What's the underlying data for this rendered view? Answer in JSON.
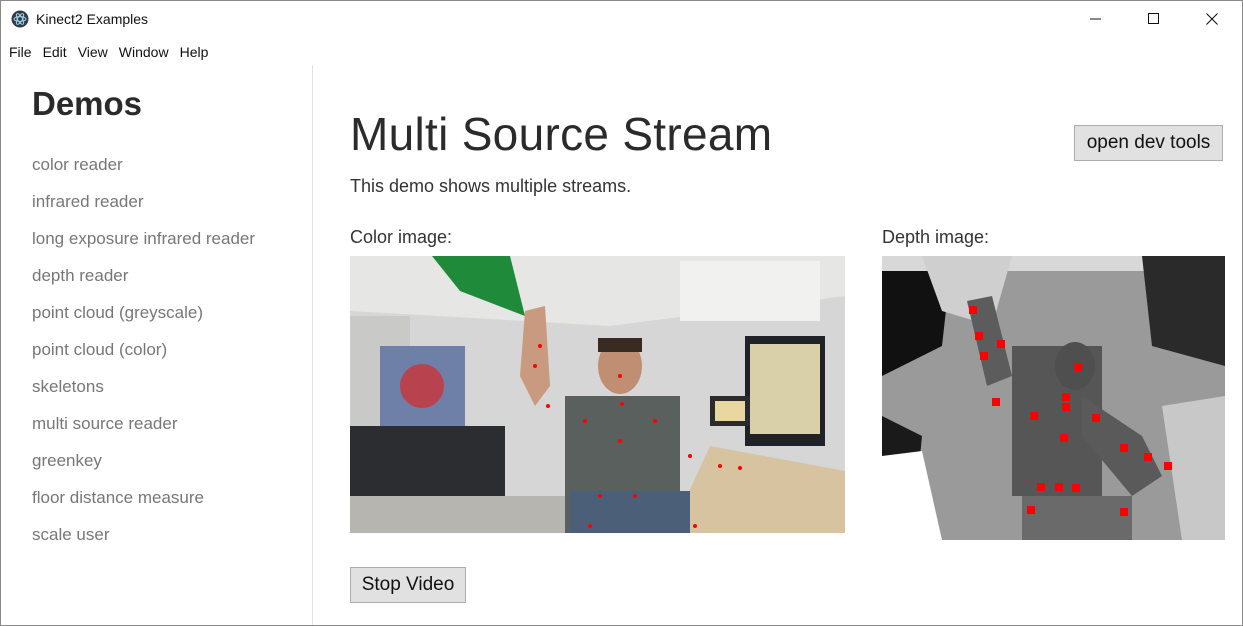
{
  "window": {
    "title": "Kinect2 Examples"
  },
  "menu": [
    "File",
    "Edit",
    "View",
    "Window",
    "Help"
  ],
  "sidebar": {
    "heading": "Demos",
    "items": [
      "color reader",
      "infrared reader",
      "long exposure infrared reader",
      "depth reader",
      "point cloud (greyscale)",
      "point cloud (color)",
      "skeletons",
      "multi source reader",
      "greenkey",
      "floor distance measure",
      "scale user"
    ]
  },
  "main": {
    "title": "Multi Source Stream",
    "subtitle": "This demo shows multiple streams.",
    "dev_tools_label": "open dev tools",
    "color_label": "Color image:",
    "depth_label": "Depth image:",
    "stop_label": "Stop Video"
  },
  "colors": {
    "joint": "#ff0000",
    "sidebar_text": "#777777"
  }
}
